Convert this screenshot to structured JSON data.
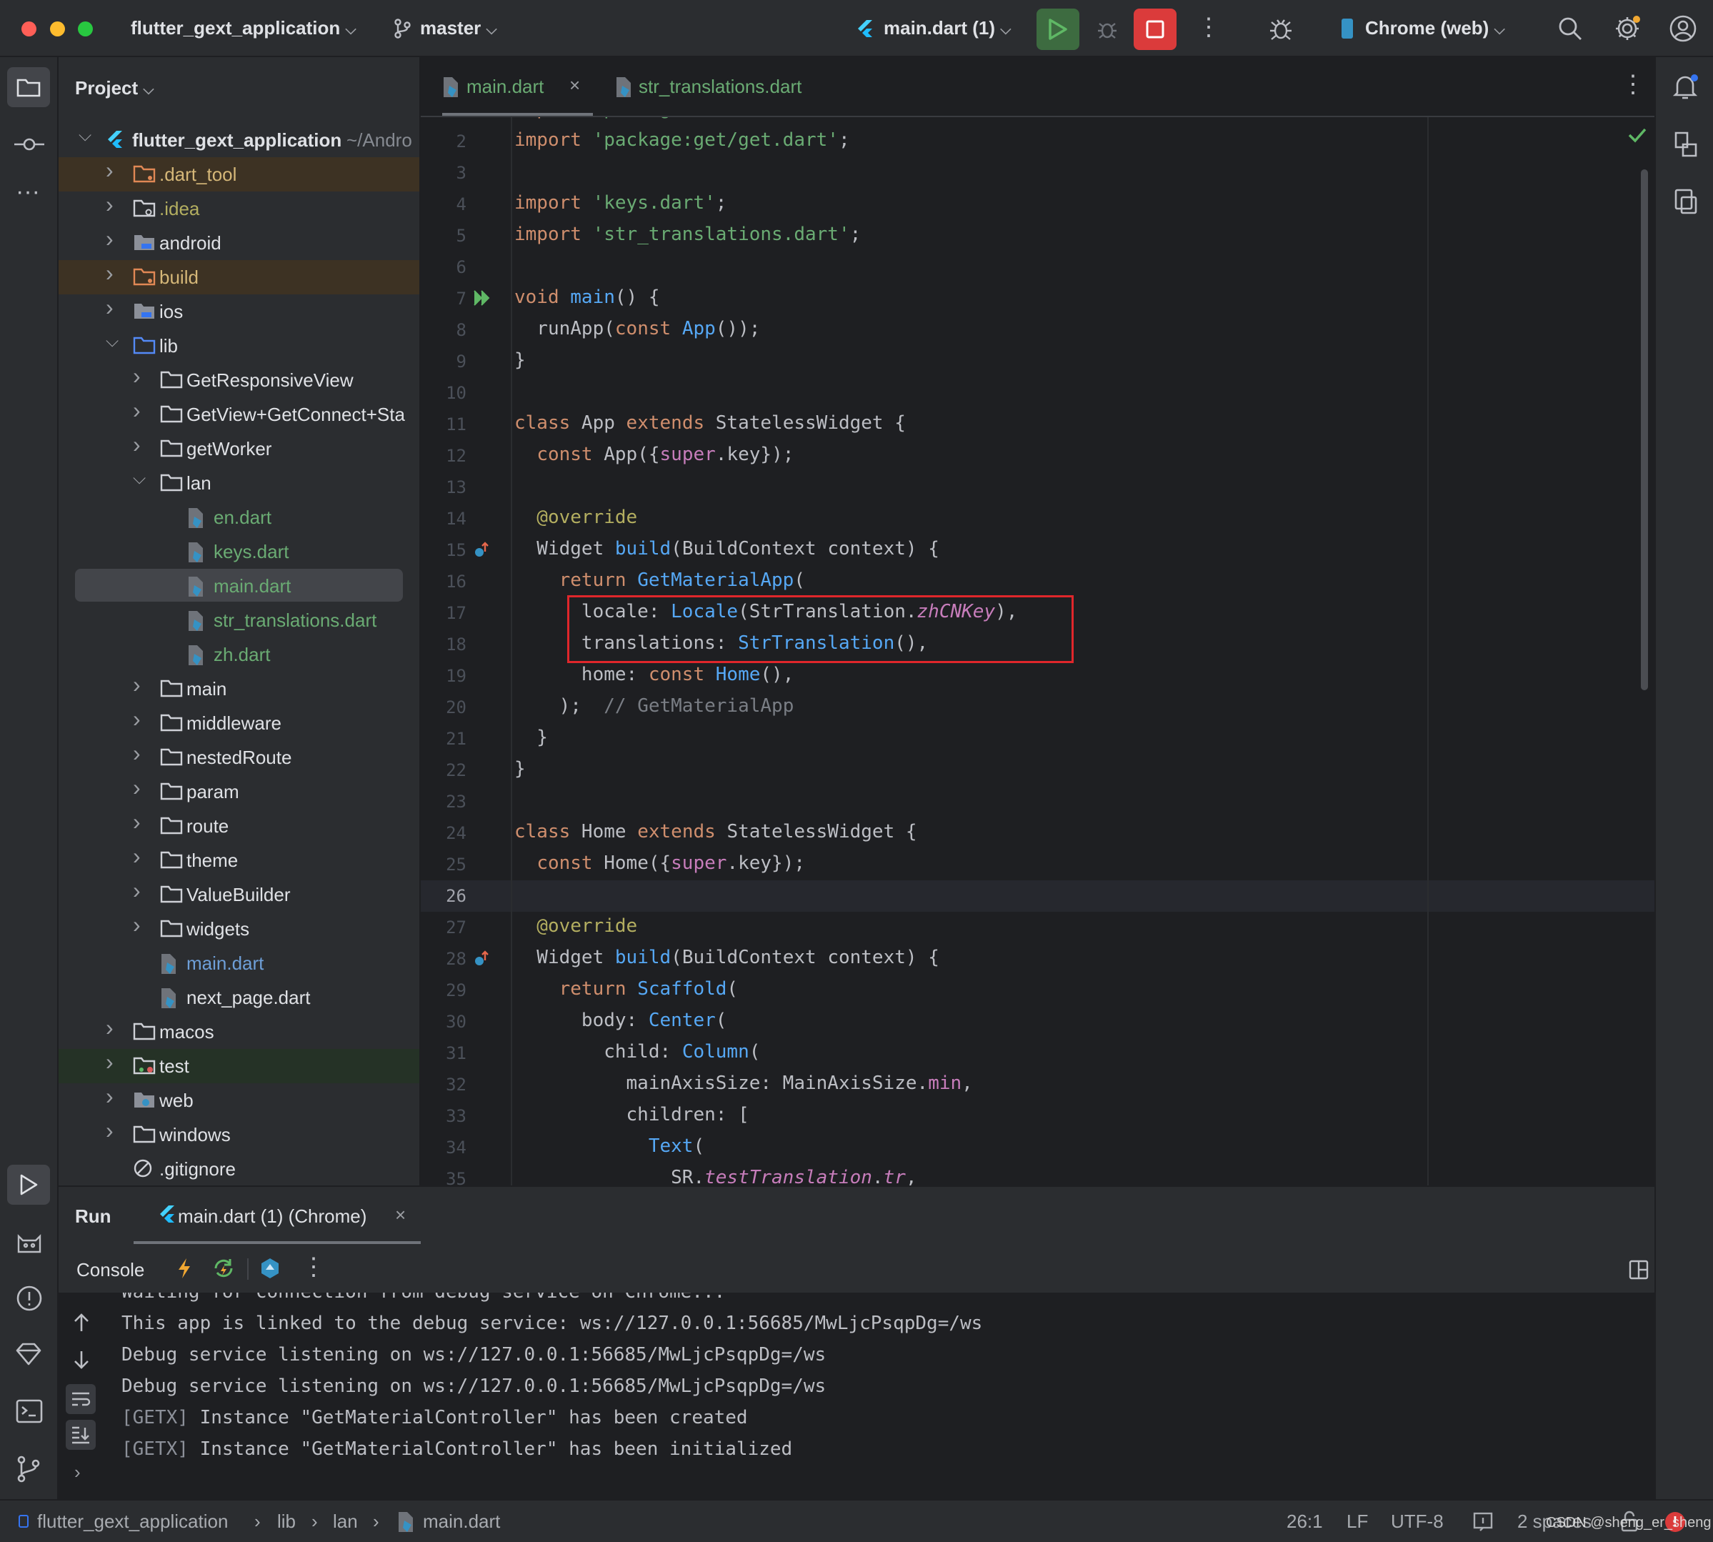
{
  "titlebar": {
    "project_name": "flutter_gext_application",
    "branch": "master",
    "run_config": "main.dart (1)",
    "device": "Chrome (web)"
  },
  "colors": {
    "accent": "#3574f0",
    "run_green": "#5fb865",
    "stop_red": "#db3b3b",
    "keyword": "#cf8e6d",
    "string": "#6aab73",
    "function": "#56a8f5",
    "highlight_box": "#e0262b"
  },
  "project": {
    "header": "Project",
    "items": [
      {
        "level": 0,
        "chev": "open",
        "icon": "flutter-icon",
        "name": "flutter_gext_application",
        "suffix": "~/Andro",
        "color": "#dfe1e5",
        "bold": true
      },
      {
        "level": 1,
        "chev": "closed",
        "icon": "folder-excluded-icon",
        "name": ".dart_tool",
        "color": "#d5b778",
        "bg": "#3d3223"
      },
      {
        "level": 1,
        "chev": "closed",
        "icon": "folder-config-icon",
        "name": ".idea",
        "color": "#b3ae60"
      },
      {
        "level": 1,
        "chev": "closed",
        "icon": "folder-module-icon",
        "name": "android",
        "color": "#dfe1e5"
      },
      {
        "level": 1,
        "chev": "closed",
        "icon": "folder-excluded-icon",
        "name": "build",
        "color": "#d5b778",
        "bg": "#3d3223"
      },
      {
        "level": 1,
        "chev": "closed",
        "icon": "folder-module-icon",
        "name": "ios",
        "color": "#dfe1e5"
      },
      {
        "level": 1,
        "chev": "open",
        "icon": "folder-source-icon",
        "name": "lib",
        "color": "#dfe1e5"
      },
      {
        "level": 2,
        "chev": "closed",
        "icon": "folder-icon",
        "name": "GetResponsiveView",
        "color": "#dfe1e5"
      },
      {
        "level": 2,
        "chev": "closed",
        "icon": "folder-icon",
        "name": "GetView+GetConnect+Sta",
        "color": "#dfe1e5"
      },
      {
        "level": 2,
        "chev": "closed",
        "icon": "folder-icon",
        "name": "getWorker",
        "color": "#dfe1e5"
      },
      {
        "level": 2,
        "chev": "open",
        "icon": "folder-icon",
        "name": "lan",
        "color": "#dfe1e5"
      },
      {
        "level": 3,
        "icon": "dart-file-icon",
        "name": "en.dart",
        "color": "#6aab73"
      },
      {
        "level": 3,
        "icon": "dart-file-icon",
        "name": "keys.dart",
        "color": "#6aab73"
      },
      {
        "level": 3,
        "icon": "dart-file-icon",
        "name": "main.dart",
        "color": "#6aab73",
        "selected": true
      },
      {
        "level": 3,
        "icon": "dart-file-icon",
        "name": "str_translations.dart",
        "color": "#6aab73"
      },
      {
        "level": 3,
        "icon": "dart-file-icon",
        "name": "zh.dart",
        "color": "#6aab73"
      },
      {
        "level": 2,
        "chev": "closed",
        "icon": "folder-icon",
        "name": "main",
        "color": "#dfe1e5"
      },
      {
        "level": 2,
        "chev": "closed",
        "icon": "folder-icon",
        "name": "middleware",
        "color": "#dfe1e5"
      },
      {
        "level": 2,
        "chev": "closed",
        "icon": "folder-icon",
        "name": "nestedRoute",
        "color": "#dfe1e5"
      },
      {
        "level": 2,
        "chev": "closed",
        "icon": "folder-icon",
        "name": "param",
        "color": "#dfe1e5"
      },
      {
        "level": 2,
        "chev": "closed",
        "icon": "folder-icon",
        "name": "route",
        "color": "#dfe1e5"
      },
      {
        "level": 2,
        "chev": "closed",
        "icon": "folder-icon",
        "name": "theme",
        "color": "#dfe1e5"
      },
      {
        "level": 2,
        "chev": "closed",
        "icon": "folder-icon",
        "name": "ValueBuilder",
        "color": "#dfe1e5"
      },
      {
        "level": 2,
        "chev": "closed",
        "icon": "folder-icon",
        "name": "widgets",
        "color": "#dfe1e5"
      },
      {
        "level": 2,
        "icon": "dart-file-icon",
        "name": "main.dart",
        "color": "#6e9fd8"
      },
      {
        "level": 2,
        "icon": "dart-file-icon",
        "name": "next_page.dart",
        "color": "#dfe1e5"
      },
      {
        "level": 1,
        "chev": "closed",
        "icon": "folder-icon",
        "name": "macos",
        "color": "#dfe1e5"
      },
      {
        "level": 1,
        "chev": "closed",
        "icon": "folder-test-icon",
        "name": "test",
        "color": "#dfe1e5",
        "bg": "#253226"
      },
      {
        "level": 1,
        "chev": "closed",
        "icon": "folder-web-icon",
        "name": "web",
        "color": "#dfe1e5"
      },
      {
        "level": 1,
        "chev": "closed",
        "icon": "folder-icon",
        "name": "windows",
        "color": "#dfe1e5"
      },
      {
        "level": 1,
        "icon": "ignore-file-icon",
        "name": ".gitignore",
        "color": "#dfe1e5"
      }
    ]
  },
  "tabs": [
    {
      "label": "main.dart",
      "active": true,
      "closable": true
    },
    {
      "label": "str_translations.dart",
      "active": false
    }
  ],
  "editor": {
    "current_line": 26,
    "lines": [
      [
        [
          "k",
          "import "
        ],
        [
          "s",
          "'package:flutter/material.dart'"
        ],
        [
          "t",
          ";"
        ]
      ],
      [
        [
          "k",
          "import "
        ],
        [
          "s",
          "'package:get/get.dart'"
        ],
        [
          "t",
          ";"
        ]
      ],
      [],
      [
        [
          "k",
          "import "
        ],
        [
          "s",
          "'keys.dart'"
        ],
        [
          "t",
          ";"
        ]
      ],
      [
        [
          "k",
          "import "
        ],
        [
          "s",
          "'str_translations.dart'"
        ],
        [
          "t",
          ";"
        ]
      ],
      [],
      [
        [
          "k",
          "void "
        ],
        [
          "f",
          "main"
        ],
        [
          "t",
          "() {"
        ]
      ],
      [
        [
          "t",
          "  runApp("
        ],
        [
          "k",
          "const "
        ],
        [
          "f",
          "App"
        ],
        [
          "t",
          "());"
        ]
      ],
      [
        [
          "t",
          "}"
        ]
      ],
      [],
      [
        [
          "k",
          "class "
        ],
        [
          "t",
          "App "
        ],
        [
          "k",
          "extends "
        ],
        [
          "t",
          "StatelessWidget {"
        ]
      ],
      [
        [
          "t",
          "  "
        ],
        [
          "k",
          "const "
        ],
        [
          "t",
          "App({"
        ],
        [
          "q",
          "super"
        ],
        [
          "t",
          ".key});"
        ]
      ],
      [],
      [
        [
          "a",
          "  @override"
        ]
      ],
      [
        [
          "t",
          "  Widget "
        ],
        [
          "f",
          "build"
        ],
        [
          "t",
          "(BuildContext context) {"
        ]
      ],
      [
        [
          "k",
          "    return "
        ],
        [
          "f",
          "GetMaterialApp"
        ],
        [
          "t",
          "("
        ]
      ],
      [
        [
          "t",
          "      locale: "
        ],
        [
          "f",
          "Locale"
        ],
        [
          "t",
          "(StrTranslation."
        ],
        [
          "p",
          "zhCNKey"
        ],
        [
          "t",
          "),"
        ]
      ],
      [
        [
          "t",
          "      translations: "
        ],
        [
          "f",
          "StrTranslation"
        ],
        [
          "t",
          "(),"
        ]
      ],
      [
        [
          "t",
          "      home: "
        ],
        [
          "k",
          "const "
        ],
        [
          "f",
          "Home"
        ],
        [
          "t",
          "(),"
        ]
      ],
      [
        [
          "t",
          "    );  "
        ],
        [
          "c",
          "// GetMaterialApp"
        ]
      ],
      [
        [
          "t",
          "  }"
        ]
      ],
      [
        [
          "t",
          "}"
        ]
      ],
      [],
      [
        [
          "k",
          "class "
        ],
        [
          "t",
          "Home "
        ],
        [
          "k",
          "extends "
        ],
        [
          "t",
          "StatelessWidget {"
        ]
      ],
      [
        [
          "t",
          "  "
        ],
        [
          "k",
          "const "
        ],
        [
          "t",
          "Home({"
        ],
        [
          "q",
          "super"
        ],
        [
          "t",
          ".key});"
        ]
      ],
      [],
      [
        [
          "a",
          "  @override"
        ]
      ],
      [
        [
          "t",
          "  Widget "
        ],
        [
          "f",
          "build"
        ],
        [
          "t",
          "(BuildContext context) {"
        ]
      ],
      [
        [
          "k",
          "    return "
        ],
        [
          "f",
          "Scaffold"
        ],
        [
          "t",
          "("
        ]
      ],
      [
        [
          "t",
          "      body: "
        ],
        [
          "f",
          "Center"
        ],
        [
          "t",
          "("
        ]
      ],
      [
        [
          "t",
          "        child: "
        ],
        [
          "f",
          "Column"
        ],
        [
          "t",
          "("
        ]
      ],
      [
        [
          "t",
          "          mainAxisSize: MainAxisSize."
        ],
        [
          "q",
          "min"
        ],
        [
          "t",
          ","
        ]
      ],
      [
        [
          "t",
          "          children: ["
        ]
      ],
      [
        [
          "t",
          "            "
        ],
        [
          "f",
          "Text"
        ],
        [
          "t",
          "("
        ]
      ],
      [
        [
          "t",
          "              SR."
        ],
        [
          "p",
          "testTranslation"
        ],
        [
          "t",
          "."
        ],
        [
          "p",
          "tr"
        ],
        [
          "t",
          ","
        ]
      ]
    ]
  },
  "run": {
    "title": "Run",
    "tab": "main.dart (1) (Chrome)",
    "console_label": "Console",
    "output": [
      [
        [
          "t",
          "Waiting for connection from debug service on Chrome..."
        ]
      ],
      [
        [
          "t",
          "This app is linked to the debug service: ws://127.0.0.1:56685/MwLjcPsqpDg=/ws"
        ]
      ],
      [
        [
          "t",
          "Debug service listening on ws://127.0.0.1:56685/MwLjcPsqpDg=/ws"
        ]
      ],
      [
        [
          "t",
          "Debug service listening on ws://127.0.0.1:56685/MwLjcPsqpDg=/ws"
        ]
      ],
      [
        [
          "g",
          "[GETX]"
        ],
        [
          "t",
          " Instance \"GetMaterialController\" has been created"
        ]
      ],
      [
        [
          "g",
          "[GETX]"
        ],
        [
          "t",
          " Instance \"GetMaterialController\" has been initialized"
        ]
      ]
    ]
  },
  "statusbar": {
    "breadcrumb": [
      "flutter_gext_application",
      "lib",
      "lan",
      "main.dart"
    ],
    "position": "26:1",
    "line_ending": "LF",
    "encoding": "UTF-8",
    "indent": "2 spaces",
    "watermark": "CSDN @sheng_er_sheng"
  }
}
